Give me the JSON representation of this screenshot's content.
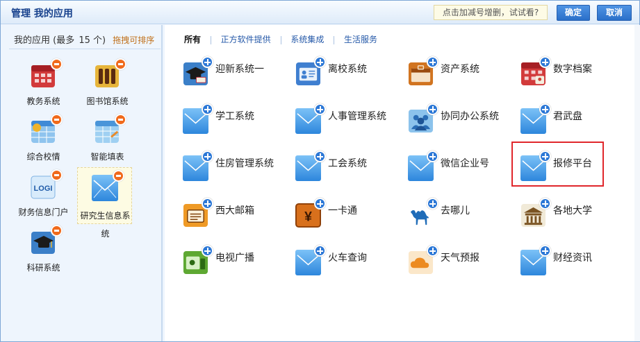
{
  "header": {
    "title": "管理  我的应用",
    "hint": "点击加减号增删，试试看?",
    "ok_label": "确定",
    "cancel_label": "取消"
  },
  "left": {
    "heading": "我的应用 (最多",
    "count": "15 个)",
    "sort_hint": "拖拽可排序",
    "items": [
      {
        "label": "教务系统",
        "icon": "calendar-red-icon"
      },
      {
        "label": "图书馆系统",
        "icon": "bookshelf-icon"
      },
      {
        "label": "综合校情",
        "icon": "calendar-chart-icon"
      },
      {
        "label": "智能填表",
        "icon": "form-table-icon"
      },
      {
        "label": "财务信息门户",
        "icon": "logi-icon"
      },
      {
        "label": "研究生信息系统",
        "icon": "mail-icon"
      },
      {
        "label": "科研系统",
        "icon": "graduation-cap-icon"
      }
    ]
  },
  "tabs": [
    "所有",
    "正方软件提供",
    "系统集成",
    "生活服务"
  ],
  "apps": [
    {
      "label": "迎新系统一",
      "icon": "graduation-cap-icon"
    },
    {
      "label": "离校系统",
      "icon": "id-card-icon"
    },
    {
      "label": "资产系统",
      "icon": "briefcase-icon"
    },
    {
      "label": "数字档案",
      "icon": "calendar-red-icon"
    },
    {
      "label": "学工系统",
      "icon": "mail-icon"
    },
    {
      "label": "人事管理系统",
      "icon": "mail-icon"
    },
    {
      "label": "协同办公系统",
      "icon": "people-group-icon"
    },
    {
      "label": "君武盘",
      "icon": "mail-icon"
    },
    {
      "label": "住房管理系统",
      "icon": "mail-icon"
    },
    {
      "label": "工会系统",
      "icon": "mail-icon"
    },
    {
      "label": "微信企业号",
      "icon": "mail-icon"
    },
    {
      "label": "报修平台",
      "icon": "mail-icon"
    },
    {
      "label": "西大邮箱",
      "icon": "mailbox-orange-icon"
    },
    {
      "label": "一卡通",
      "icon": "yen-card-icon"
    },
    {
      "label": "去哪儿",
      "icon": "camel-icon"
    },
    {
      "label": "各地大学",
      "icon": "university-building-icon"
    },
    {
      "label": "电视广播",
      "icon": "tv-broadcast-icon"
    },
    {
      "label": "火车查询",
      "icon": "mail-icon"
    },
    {
      "label": "天气预报",
      "icon": "cloud-weather-icon"
    },
    {
      "label": "财经资讯",
      "icon": "mail-icon"
    }
  ],
  "colors": {
    "accent": "#2b77d6",
    "highlight_border": "#e0262b",
    "remove_badge": "#f06a1c"
  }
}
